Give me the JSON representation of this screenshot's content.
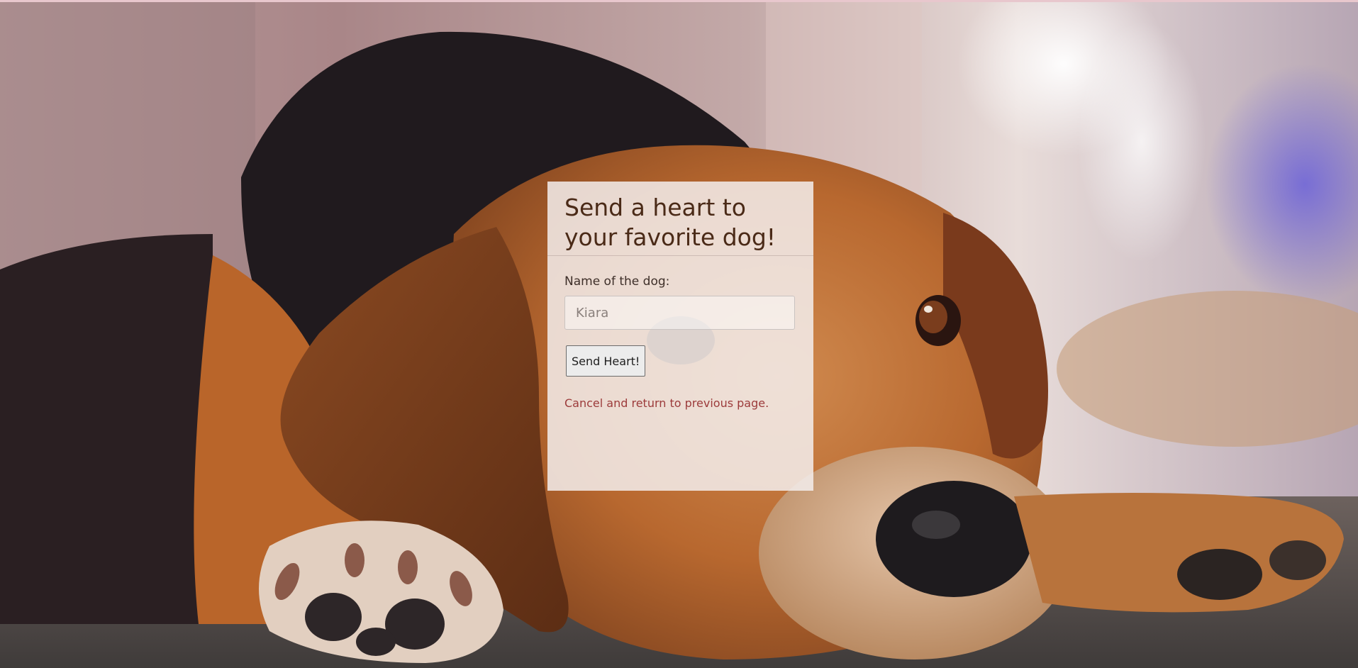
{
  "form": {
    "title_line1": "Send a heart to",
    "title_line2": "your favorite dog!",
    "name_label": "Name of the dog:",
    "name_placeholder": "Kiara",
    "submit_label": "Send Heart!",
    "cancel_link": "Cancel and return to previous page."
  },
  "background": {
    "subject": "beagle lying on the floor",
    "colors": {
      "fur_tan": "#b5652c",
      "fur_black": "#1f1a1d",
      "floor": "#4e4845",
      "backdrop": "#c9a6a8"
    }
  },
  "colors": {
    "title": "#4a2a17",
    "link": "#9c3b3b",
    "panel": "#f3edec"
  }
}
